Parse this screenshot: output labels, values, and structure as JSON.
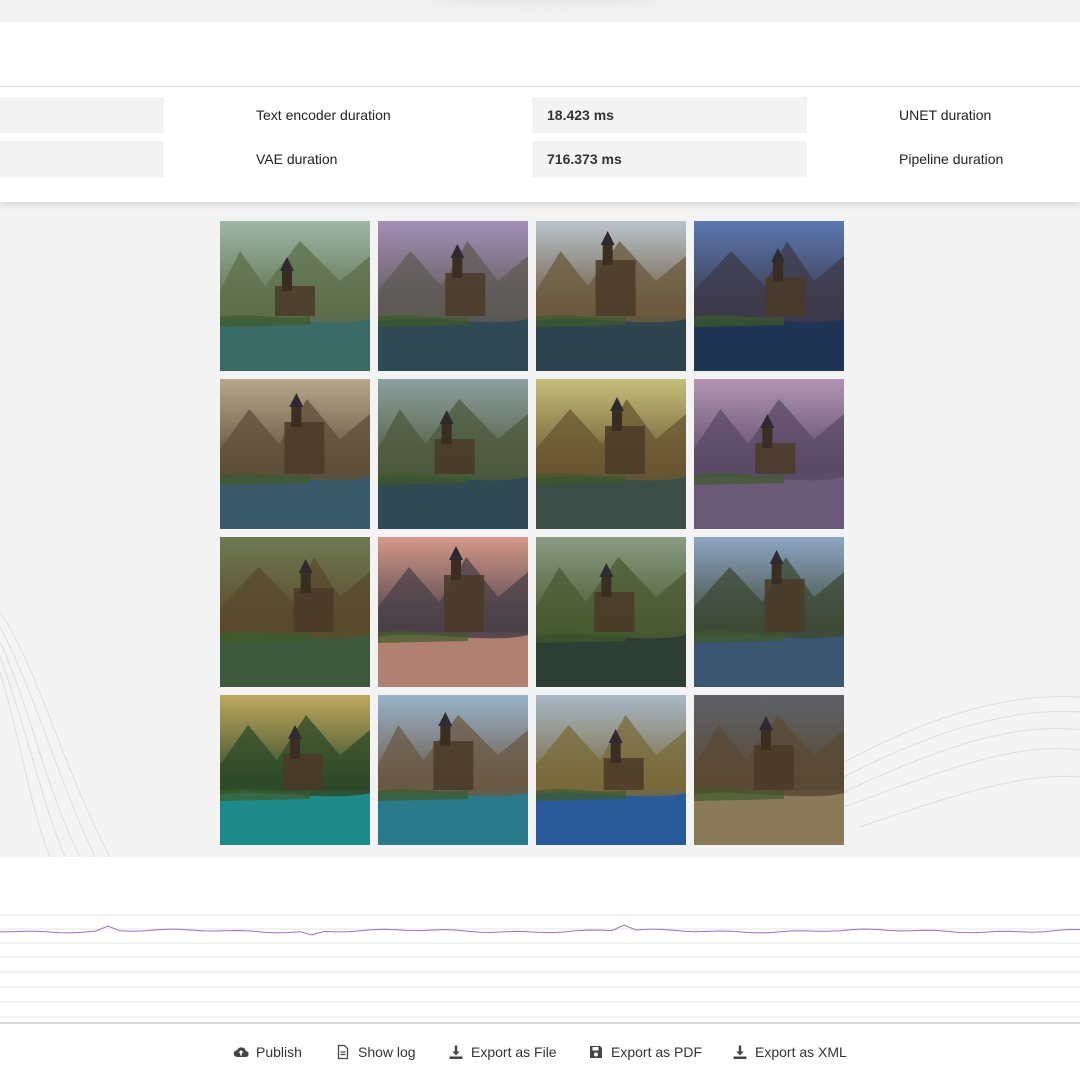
{
  "metrics": {
    "text_encoder_label": "Text encoder duration",
    "text_encoder_value": "18.423 ms",
    "unet_label": "UNET duration",
    "vae_label": "VAE duration",
    "vae_value": "716.373 ms",
    "pipeline_label": "Pipeline duration"
  },
  "gallery": {
    "images": [
      {
        "subject": "castle-lake-image",
        "sky": "#9fb7a8",
        "mid": "#5d6f4a",
        "water": "#3b6b66"
      },
      {
        "subject": "castle-lake-image",
        "sky": "#a48fb8",
        "mid": "#5e5a55",
        "water": "#2f4a55"
      },
      {
        "subject": "castle-lake-image",
        "sky": "#b9c4cc",
        "mid": "#6b5a3e",
        "water": "#2e4550"
      },
      {
        "subject": "castle-lake-image",
        "sky": "#5a78b0",
        "mid": "#3d3a4a",
        "water": "#1f3555"
      },
      {
        "subject": "castle-lake-image",
        "sky": "#b6a78e",
        "mid": "#5d4f38",
        "water": "#3a5a6a"
      },
      {
        "subject": "castle-lake-image",
        "sky": "#8fa0a0",
        "mid": "#4c5a3c",
        "water": "#2f4a52"
      },
      {
        "subject": "castle-lake-image",
        "sky": "#c6c07a",
        "mid": "#6a5632",
        "water": "#3c4c46"
      },
      {
        "subject": "castle-lake-image",
        "sky": "#b494b4",
        "mid": "#5a4a66",
        "water": "#6a5a78"
      },
      {
        "subject": "castle-lake-image",
        "sky": "#6e7a52",
        "mid": "#5a4a2c",
        "water": "#3e5a3e"
      },
      {
        "subject": "castle-lake-image",
        "sky": "#d49a8a",
        "mid": "#4a4048",
        "water": "#b08070"
      },
      {
        "subject": "castle-lake-image",
        "sky": "#8a9c82",
        "mid": "#4a5a32",
        "water": "#2e3e34"
      },
      {
        "subject": "castle-lake-image",
        "sky": "#8ea6c6",
        "mid": "#3e4a36",
        "water": "#3a5670"
      },
      {
        "subject": "castle-lake-image",
        "sky": "#c0a860",
        "mid": "#2e4a28",
        "water": "#1e8a8a"
      },
      {
        "subject": "castle-lake-image",
        "sky": "#9ab4cc",
        "mid": "#6a5a44",
        "water": "#2a7a8a"
      },
      {
        "subject": "castle-lake-image",
        "sky": "#a8b8c8",
        "mid": "#7a6a3a",
        "water": "#2a5a9a"
      },
      {
        "subject": "castle-lake-image",
        "sky": "#5e6068",
        "mid": "#5a4a34",
        "water": "#8a7a5a"
      }
    ]
  },
  "chart": {
    "line_color": "#9b6fc4",
    "gridline_color": "#e6e6e6"
  },
  "footer": {
    "publish_label": "Publish",
    "show_log_label": "Show log",
    "export_file_label": "Export as File",
    "export_pdf_label": "Export as PDF",
    "export_xml_label": "Export as XML"
  },
  "colors": {
    "panel_bg": "#ffffff",
    "page_bg": "#f3f3f3",
    "metric_box": "#f3f3f3"
  }
}
